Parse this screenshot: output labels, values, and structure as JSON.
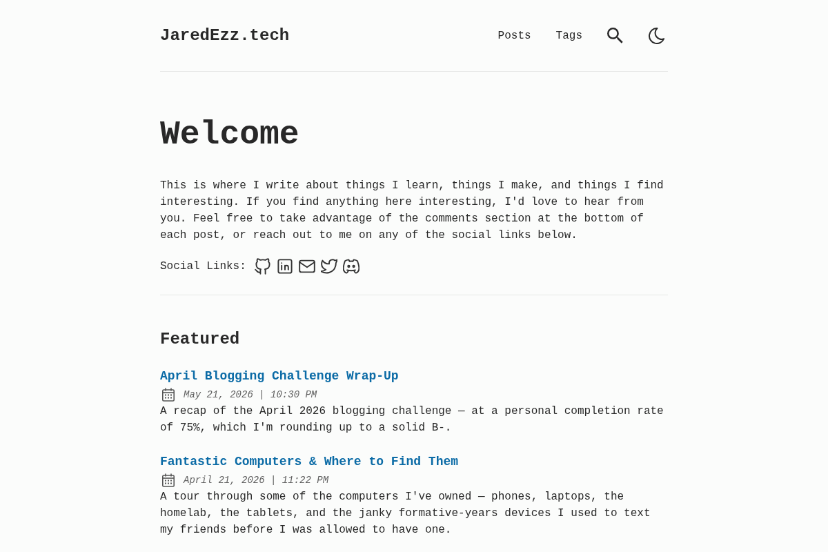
{
  "header": {
    "site_title": "JaredEzz.tech",
    "nav": [
      "Posts",
      "Tags"
    ]
  },
  "hero": {
    "title": "Welcome",
    "intro": "This is where I write about things I learn, things I make, and things I find interesting. If you find anything here interesting, I'd love to hear from you. Feel free to take advantage of the comments section at the bottom of each post, or reach out to me on any of the social links below.",
    "social_label": "Social Links:"
  },
  "featured": {
    "heading": "Featured",
    "posts": [
      {
        "title": "April Blogging Challenge Wrap-Up",
        "date": "May 21, 2026 | 10:30 PM",
        "description": "A recap of the April 2026 blogging challenge — at a personal completion rate of 75%, which I'm rounding up to a solid B-."
      },
      {
        "title": "Fantastic Computers & Where to Find Them",
        "date": "April 21, 2026 | 11:22 PM",
        "description": "A tour through some of the computers I've owned — phones, laptops, the homelab, the tablets, and the janky formative-years devices I used to text my friends before I was allowed to have one."
      }
    ]
  }
}
